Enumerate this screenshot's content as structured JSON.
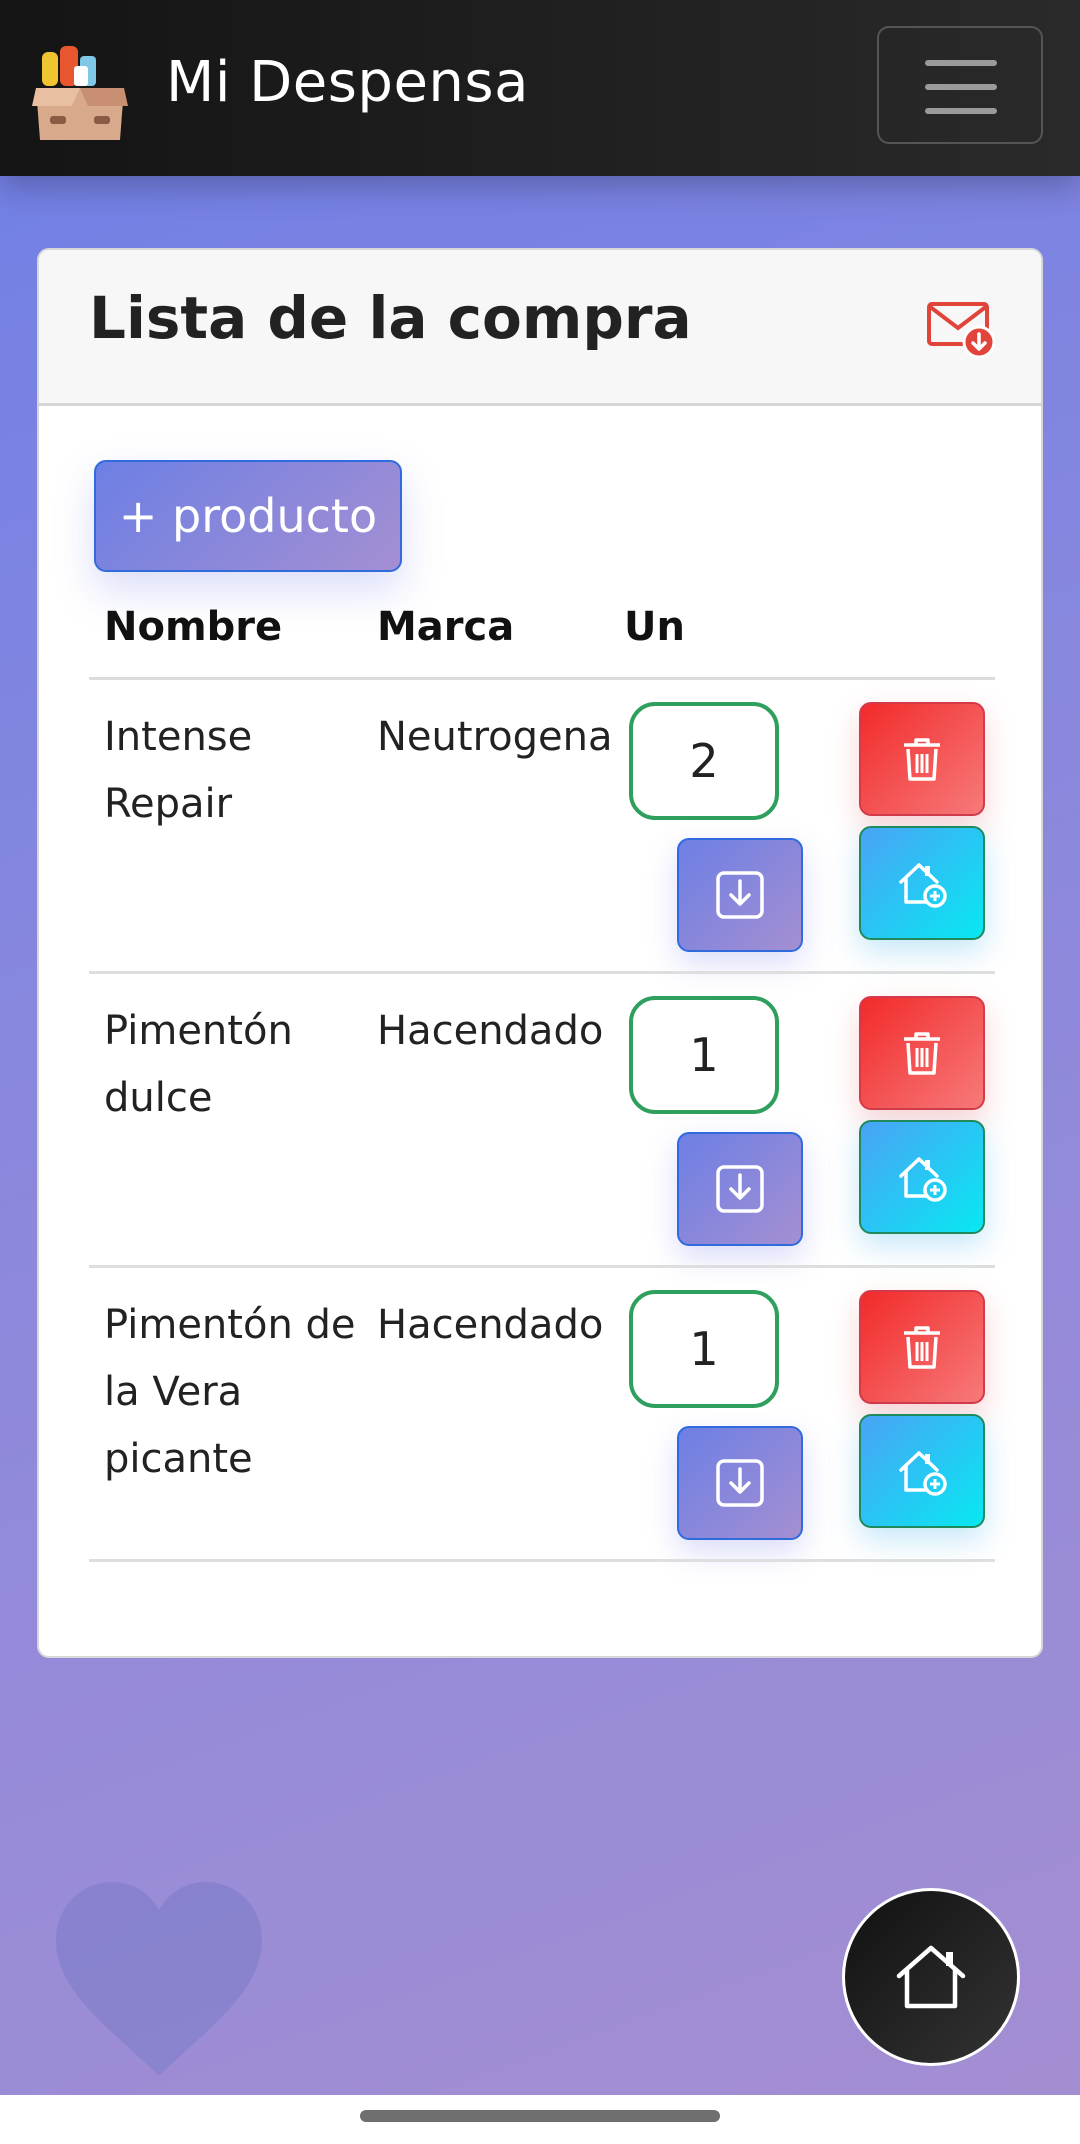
{
  "navbar": {
    "brand": "Mi Despensa",
    "menu_icon": "hamburger-icon"
  },
  "card": {
    "title": "Lista de la compra",
    "mail_icon": "envelope-download-icon",
    "add_button_label": "+ producto",
    "columns": [
      "Nombre",
      "Marca",
      "Un"
    ]
  },
  "rows": [
    {
      "name": "Intense Repair",
      "brand": "Neutrogena",
      "qty": "2"
    },
    {
      "name": "Pimentón dulce",
      "brand": "Hacendado",
      "qty": "1"
    },
    {
      "name": "Pimentón de la Vera picante",
      "brand": "Hacendado",
      "qty": "1"
    }
  ],
  "icons": {
    "delete": "trash-icon",
    "save": "download-box-icon",
    "pantry": "house-plus-icon",
    "fab": "home-icon",
    "favorite": "heart-icon"
  },
  "colors": {
    "accent_gradient_start": "#6d7fe4",
    "accent_gradient_end": "#a48fd2",
    "danger": "#f22a2a",
    "success_border": "#2e9f5c",
    "cyan": "#08e8f2"
  }
}
